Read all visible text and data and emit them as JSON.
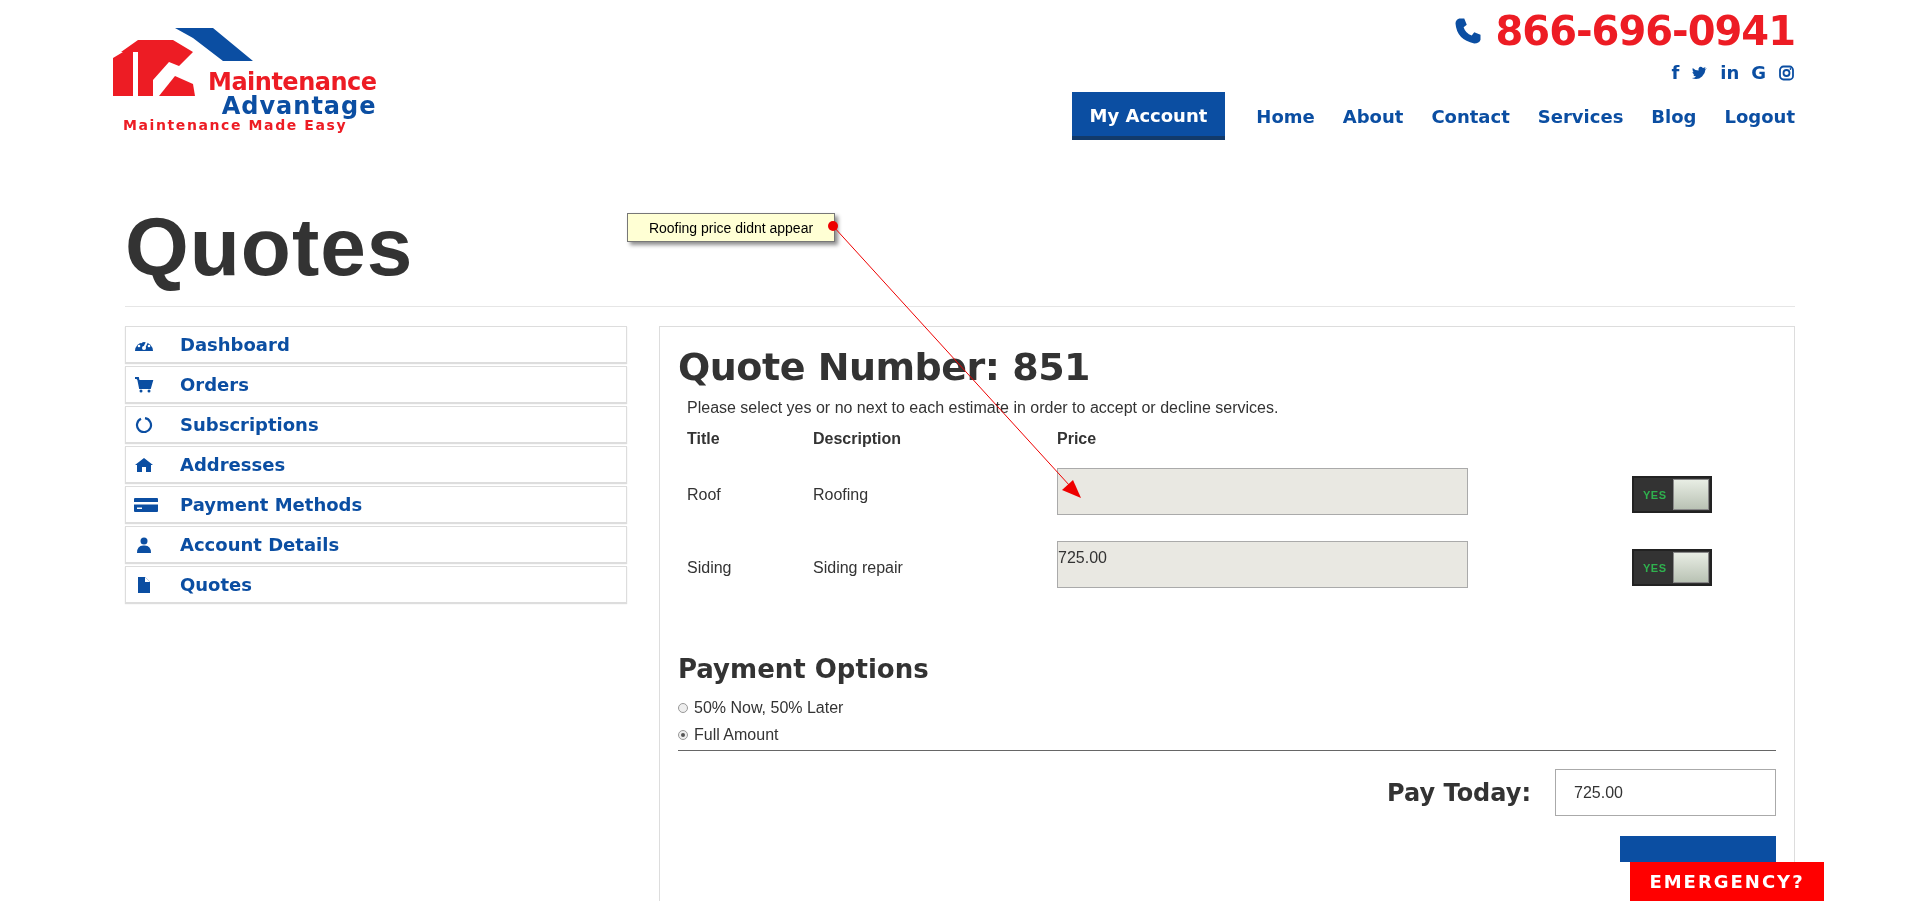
{
  "logo": {
    "line1": "Maintenance",
    "line2": "Advantage",
    "tagline": "Maintenance Made Easy"
  },
  "phone": "866-696-0941",
  "social": [
    {
      "kind": "glyph",
      "text": "f"
    },
    {
      "kind": "bird"
    },
    {
      "kind": "glyph",
      "text": "in"
    },
    {
      "kind": "glyph",
      "text": "G"
    },
    {
      "kind": "camera"
    }
  ],
  "nav": [
    {
      "label": "My Account",
      "selected": true
    },
    {
      "label": "Home",
      "selected": false
    },
    {
      "label": "About",
      "selected": false
    },
    {
      "label": "Contact",
      "selected": false
    },
    {
      "label": "Services",
      "selected": false
    },
    {
      "label": "Blog",
      "selected": false
    },
    {
      "label": "Logout",
      "selected": false
    }
  ],
  "page_title": "Quotes",
  "annotation": {
    "note": "Roofing price didnt appear"
  },
  "sidebar": {
    "items": [
      {
        "label": "Dashboard",
        "kind": "gauge"
      },
      {
        "label": "Orders",
        "kind": "cart"
      },
      {
        "label": "Subscriptions",
        "kind": "ring"
      },
      {
        "label": "Addresses",
        "kind": "house"
      },
      {
        "label": "Payment Methods",
        "kind": "card"
      },
      {
        "label": "Account Details",
        "kind": "person"
      },
      {
        "label": "Quotes",
        "kind": "file"
      }
    ]
  },
  "quote": {
    "heading": "Quote Number: 851",
    "instructions": "Please select yes or no next to each estimate in order to accept or decline services.",
    "columns": [
      "Title",
      "Description",
      "Price"
    ],
    "rows": [
      {
        "title": "Roof",
        "description": "Roofing",
        "accepted": true,
        "toggle_label": "YES"
      },
      {
        "title": "Siding",
        "description": "Siding repair",
        "price": "725.00",
        "accepted": true,
        "toggle_label": "YES"
      }
    ],
    "payment_heading": "Payment Options",
    "payment_options": [
      {
        "label": "50% Now, 50% Later",
        "selected": false
      },
      {
        "label": "Full Amount",
        "selected": true
      }
    ],
    "pay_today_label": "Pay Today:",
    "pay_today": "725.00"
  },
  "emergency": "EMERGENCY?"
}
